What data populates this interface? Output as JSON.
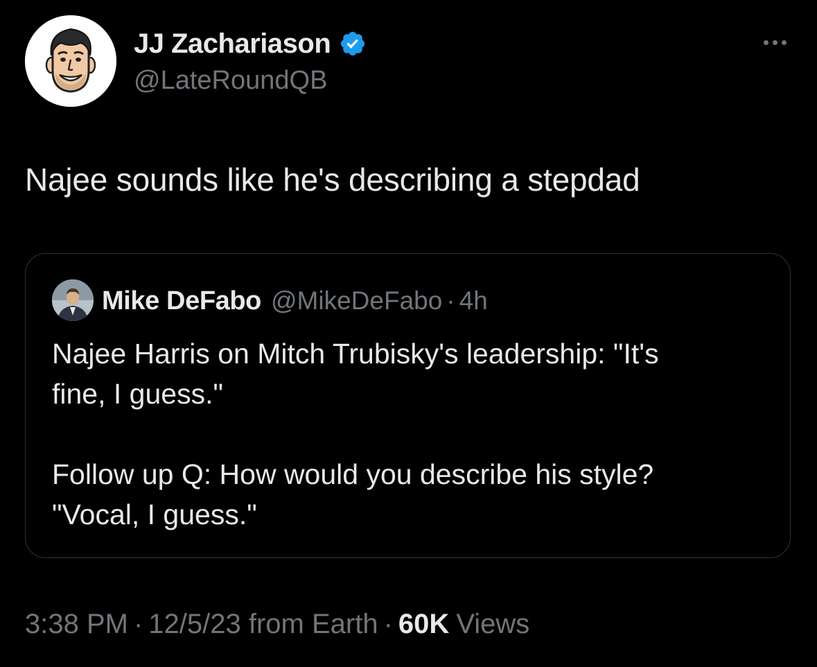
{
  "author": {
    "name": "JJ Zachariason",
    "handle": "@LateRoundQB",
    "verified": true,
    "avatar_icon": "cartoon-face-avatar"
  },
  "more_icon": "more-horizontal-icon",
  "tweet": {
    "text": "Najee sounds like he's describing a stepdad"
  },
  "quote": {
    "author_name": "Mike DeFabo",
    "author_handle": "@MikeDeFabo",
    "separator": "·",
    "time": "4h",
    "avatar_icon": "person-photo-avatar",
    "paragraph1": "Najee Harris on Mitch Trubisky's leadership: \"It's\nfine, I guess.\"",
    "paragraph2": "Follow up Q: How would you describe his style?\n\"Vocal, I guess.\""
  },
  "meta": {
    "time": "3:38 PM",
    "separator": "·",
    "date_location": "12/5/23 from Earth",
    "views_count": "60K",
    "views_label": "Views"
  },
  "colors": {
    "background": "#000000",
    "primary_text": "#e7e9ea",
    "secondary_text": "#71767b",
    "border": "#2f3336",
    "verified_blue": "#1d9bf0"
  }
}
